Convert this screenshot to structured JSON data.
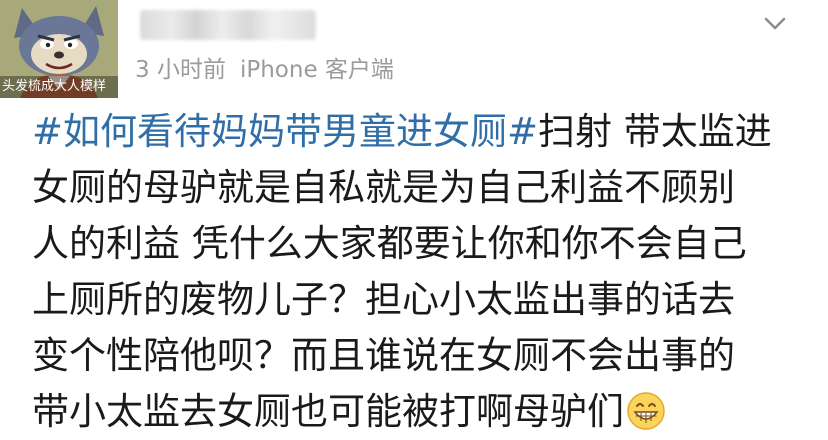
{
  "avatar": {
    "caption": "头发梳成大人模样",
    "icon": "cartoon-cat-avatar"
  },
  "header": {
    "time": "3 小时前",
    "source": "iPhone 客户端",
    "menu_icon": "chevron-down-icon"
  },
  "post": {
    "hashtag": "#如何看待妈妈带男童进女厕#",
    "lines": [
      "扫射 带太监进",
      "女厕的母驴就是自私就是为自己利益不顾别",
      "人的利益 凭什么大家都要让你和你不会自己",
      "上厕所的废物儿子？担心小太监出事的话去",
      "变个性陪他呗？而且谁说在女厕不会出事的",
      "带小太监去女厕也可能被打啊母驴们"
    ],
    "emoji": "grinning-face-emoji"
  },
  "colors": {
    "hashtag": "#2f6ea6",
    "text": "#1a1a1a",
    "meta": "#9b9b9b"
  }
}
